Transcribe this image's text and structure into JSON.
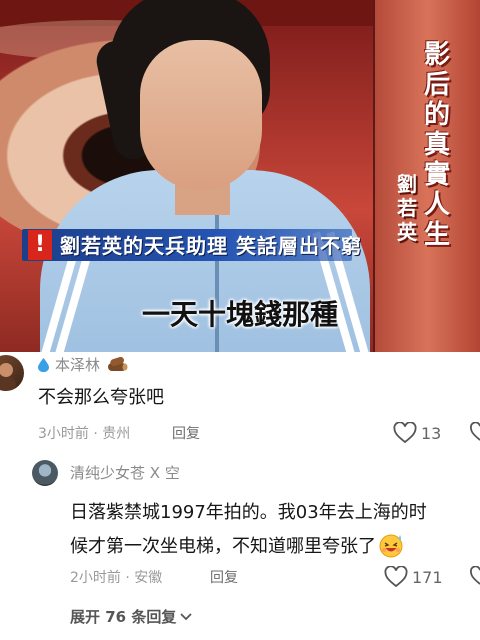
{
  "video": {
    "show_title": "影后的真實人生",
    "guest_name": "劉若英",
    "banner_mark": "!",
    "banner": "劉若英的天兵助理  笑話層出不窮",
    "subtitle": "一天十塊錢那種"
  },
  "comments": [
    {
      "username": "本泽林",
      "text": "不会那么夸张吧",
      "meta": "3小时前 · 贵州",
      "reply_label": "回复",
      "likes": "13",
      "badges": [
        "water-drop-icon",
        "wood-log-icon"
      ]
    },
    {
      "username": "清纯少女苍 X 空",
      "text_lines": [
        "日落紫禁城1997年拍的。我03年去上海的时",
        "候才第一次坐电梯，不知道哪里夸张了"
      ],
      "meta": "2小时前 · 安徽",
      "reply_label": "回复",
      "likes": "171",
      "emoji": "laughing-sweat-emoji"
    }
  ],
  "expand_replies": "展开 76 条回复"
}
